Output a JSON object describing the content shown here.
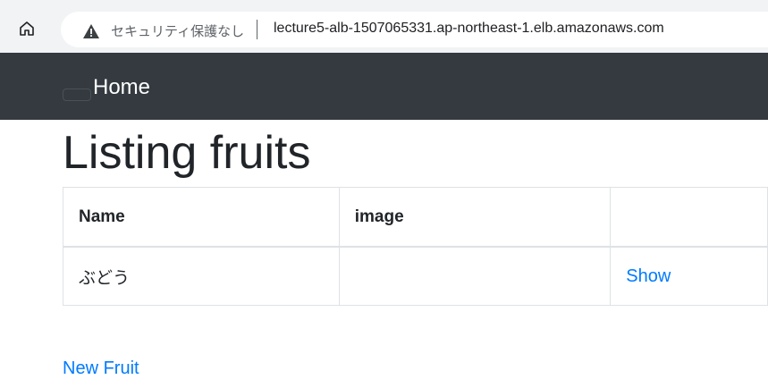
{
  "browser": {
    "security_text": "セキュリティ保護なし",
    "url": "lecture5-alb-1507065331.ap-northeast-1.elb.amazonaws.com"
  },
  "navbar": {
    "home_label": "Home"
  },
  "page": {
    "title": "Listing fruits"
  },
  "table": {
    "headers": [
      "Name",
      "image",
      ""
    ],
    "rows": [
      {
        "name": "ぶどう",
        "image": "",
        "action": "Show"
      }
    ]
  },
  "actions": {
    "new_fruit": "New Fruit"
  },
  "colors": {
    "navbar_bg": "#343a40",
    "link": "#007bff",
    "text": "#212529",
    "border": "#dee2e6"
  }
}
